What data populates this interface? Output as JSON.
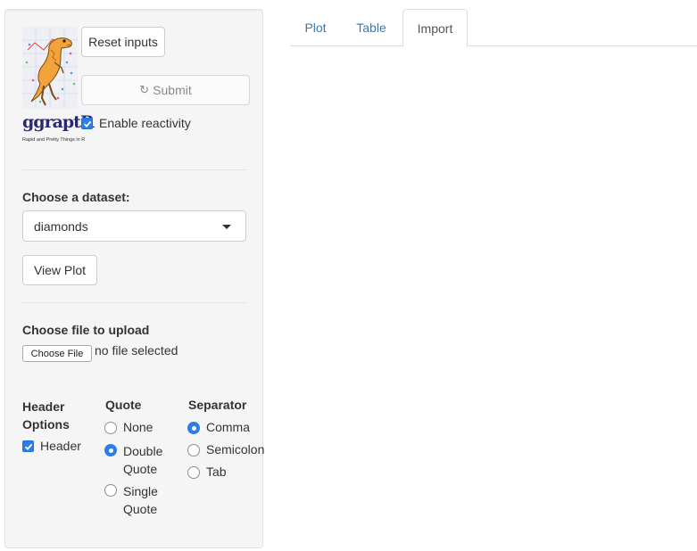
{
  "sidebar": {
    "logo": {
      "name": "ggraptR",
      "tagline": "Rapid and Pretty Things in R"
    },
    "reset_label": "Reset inputs",
    "submit_label": "Submit",
    "reactivity_label": "Enable reactivity",
    "reactivity_checked": true,
    "dataset_label": "Choose a dataset:",
    "dataset_value": "diamonds",
    "view_plot_label": "View Plot",
    "upload_label": "Choose file to upload",
    "choose_file_label": "Choose File",
    "no_file_label": "no file selected",
    "header_options": {
      "title_line1": "Header",
      "title_line2": "Options",
      "header_label": "Header",
      "header_checked": true
    },
    "quote": {
      "title": "Quote",
      "options": [
        {
          "line1": "None",
          "line2": "",
          "selected": false
        },
        {
          "line1": "Double",
          "line2": "Quote",
          "selected": true
        },
        {
          "line1": "Single",
          "line2": "Quote",
          "selected": false
        }
      ]
    },
    "separator": {
      "title": "Separator",
      "options": [
        {
          "label": "Comma",
          "selected": true
        },
        {
          "label": "Semicolon",
          "selected": false
        },
        {
          "label": "Tab",
          "selected": false
        }
      ]
    }
  },
  "tabs": [
    {
      "label": "Plot",
      "active": false
    },
    {
      "label": "Table",
      "active": false
    },
    {
      "label": "Import",
      "active": true
    }
  ],
  "colors": {
    "accent": "#2b7de9",
    "link": "#337ab7",
    "panel": "#f5f5f5"
  }
}
